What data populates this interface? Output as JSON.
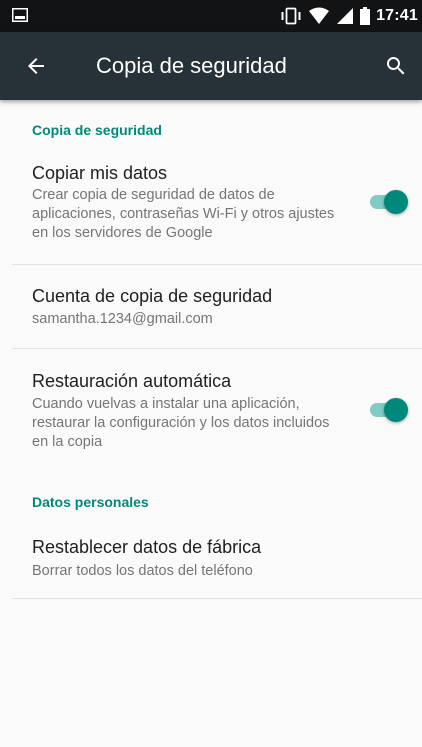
{
  "status_bar": {
    "time": "17:41",
    "icons": [
      "image-notification-icon",
      "vibrate-icon",
      "wifi-icon",
      "signal-icon",
      "battery-icon"
    ]
  },
  "app_bar": {
    "title": "Copia de seguridad",
    "back_icon": "arrow-back-icon",
    "search_icon": "search-icon"
  },
  "sections": [
    {
      "header": "Copia de seguridad",
      "items": [
        {
          "title": "Copiar mis datos",
          "summary": "Crear copia de seguridad de datos de aplicaciones, contraseñas Wi-Fi y otros ajustes en los servidores de Google",
          "switch_on": true
        },
        {
          "title": "Cuenta de copia de seguridad",
          "summary": "samantha.1234@gmail.com"
        },
        {
          "title": "Restauración automática",
          "summary": "Cuando vuelvas a instalar una aplicación, restaurar la configuración y los datos incluidos en la copia",
          "switch_on": true
        }
      ]
    },
    {
      "header": "Datos personales",
      "items": [
        {
          "title": "Restablecer datos de fábrica",
          "summary": "Borrar todos los datos del teléfono"
        }
      ]
    }
  ],
  "colors": {
    "status_bar": "#111315",
    "app_bar": "#263238",
    "accent": "#00897b",
    "accent_light": "#80cbc4",
    "background": "#fafafa",
    "title_text": "#212121",
    "summary_text": "#757575",
    "divider": "#e0e0e0"
  }
}
